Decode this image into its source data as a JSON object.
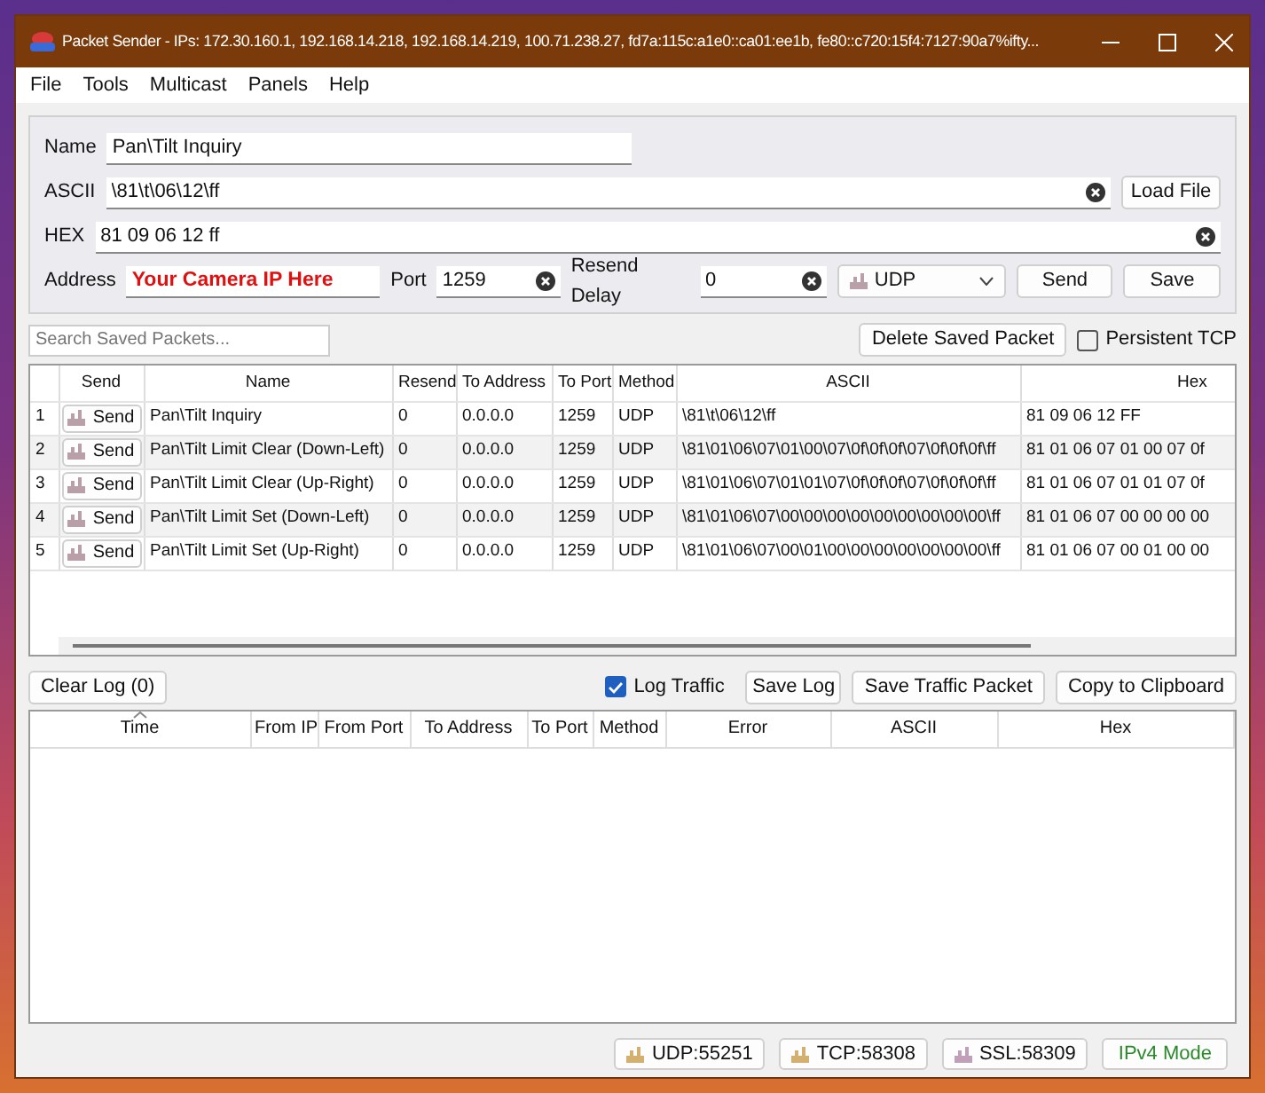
{
  "window": {
    "title": "Packet Sender - IPs: 172.30.160.1, 192.168.14.218, 192.168.14.219, 100.71.238.27, fd7a:115c:a1e0::ca01:ee1b, fe80::c720:15f4:7127:90a7%ifty..."
  },
  "menu": [
    "File",
    "Tools",
    "Multicast",
    "Panels",
    "Help"
  ],
  "form": {
    "name": {
      "label": "Name",
      "value": "Pan\\Tilt Inquiry"
    },
    "ascii": {
      "label": "ASCII",
      "value": "\\81\\t\\06\\12\\ff"
    },
    "load_file": "Load File",
    "hex": {
      "label": "HEX",
      "value": "81 09 06 12 ff"
    },
    "address": {
      "label": "Address",
      "value": "Your Camera IP Here"
    },
    "port": {
      "label": "Port",
      "value": "1259"
    },
    "resend_delay": {
      "label": "Resend Delay",
      "value": "0"
    },
    "protocol": "UDP",
    "send": "Send",
    "save": "Save"
  },
  "search": {
    "placeholder": "Search Saved Packets..."
  },
  "delete_saved": "Delete Saved Packet",
  "persistent_tcp": {
    "label": "Persistent TCP",
    "checked": false
  },
  "packets": {
    "columns": [
      "Send",
      "Name",
      "Resend",
      "To Address",
      "To Port",
      "Method",
      "ASCII",
      "Hex"
    ],
    "rows": [
      {
        "index": "1",
        "send": "Send",
        "name": "Pan\\Tilt Inquiry",
        "resend": "0",
        "to_address": "0.0.0.0",
        "to_port": "1259",
        "method": "UDP",
        "ascii": "\\81\\t\\06\\12\\ff",
        "hex": "81 09 06 12 FF"
      },
      {
        "index": "2",
        "send": "Send",
        "name": "Pan\\Tilt Limit Clear (Down-Left)",
        "resend": "0",
        "to_address": "0.0.0.0",
        "to_port": "1259",
        "method": "UDP",
        "ascii": "\\81\\01\\06\\07\\01\\00\\07\\0f\\0f\\0f\\07\\0f\\0f\\0f\\ff",
        "hex": "81 01 06 07 01 00 07 0f"
      },
      {
        "index": "3",
        "send": "Send",
        "name": "Pan\\Tilt Limit Clear (Up-Right)",
        "resend": "0",
        "to_address": "0.0.0.0",
        "to_port": "1259",
        "method": "UDP",
        "ascii": "\\81\\01\\06\\07\\01\\01\\07\\0f\\0f\\0f\\07\\0f\\0f\\0f\\ff",
        "hex": "81 01 06 07 01 01 07 0f"
      },
      {
        "index": "4",
        "send": "Send",
        "name": "Pan\\Tilt Limit Set (Down-Left)",
        "resend": "0",
        "to_address": "0.0.0.0",
        "to_port": "1259",
        "method": "UDP",
        "ascii": "\\81\\01\\06\\07\\00\\00\\00\\00\\00\\00\\00\\00\\00\\ff",
        "hex": "81 01 06 07 00 00 00 00"
      },
      {
        "index": "5",
        "send": "Send",
        "name": "Pan\\Tilt Limit Set (Up-Right)",
        "resend": "0",
        "to_address": "0.0.0.0",
        "to_port": "1259",
        "method": "UDP",
        "ascii": "\\81\\01\\06\\07\\00\\01\\00\\00\\00\\00\\00\\00\\00\\ff",
        "hex": "81 01 06 07 00 01 00 00"
      }
    ]
  },
  "log": {
    "clear": "Clear Log (0)",
    "log_traffic": {
      "label": "Log Traffic",
      "checked": true
    },
    "save_log": "Save Log",
    "save_traffic_packet": "Save Traffic Packet",
    "copy_to_clipboard": "Copy to Clipboard",
    "columns": [
      {
        "label": "Time",
        "sorted": true
      },
      {
        "label": "From IP",
        "sorted": false
      },
      {
        "label": "From Port",
        "sorted": false
      },
      {
        "label": "To Address",
        "sorted": false
      },
      {
        "label": "To Port",
        "sorted": false
      },
      {
        "label": "Method",
        "sorted": false
      },
      {
        "label": "Error",
        "sorted": false
      },
      {
        "label": "ASCII",
        "sorted": false
      },
      {
        "label": "Hex",
        "sorted": false
      }
    ]
  },
  "status_bar": [
    {
      "label": "UDP:55251",
      "kind": "port"
    },
    {
      "label": "TCP:58308",
      "kind": "port"
    },
    {
      "label": "SSL:58309",
      "kind": "port"
    },
    {
      "label": "IPv4 Mode",
      "kind": "mode"
    }
  ]
}
